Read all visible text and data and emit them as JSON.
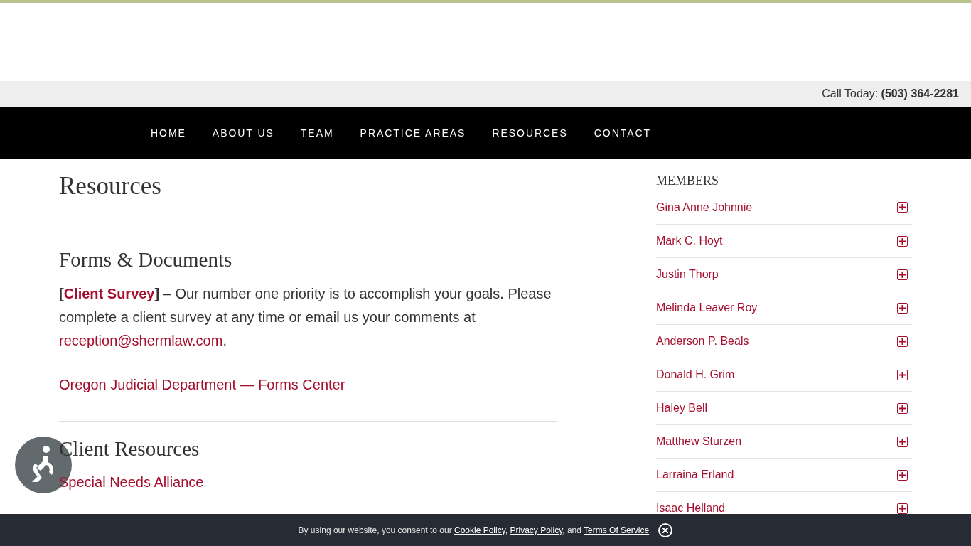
{
  "top_bar": {
    "label": "Call Today:",
    "phone": "(503) 364-2281"
  },
  "nav": [
    "HOME",
    "ABOUT US",
    "TEAM",
    "PRACTICE AREAS",
    "RESOURCES",
    "CONTACT"
  ],
  "page_title": "Resources",
  "sections": [
    {
      "heading": "Forms & Documents",
      "intro": {
        "open": "[",
        "link": "Client Survey",
        "after": "**]** – Our number one priority is to accomplish your goals. Please complete a client survey at any time or email us your comments at",
        "email": "reception@shermlaw.com",
        "end": "."
      },
      "links": [
        "Oregon Judicial Department — Forms Center"
      ]
    },
    {
      "heading": "Client Resources",
      "links": [
        "Special Needs Alliance"
      ]
    }
  ],
  "sidebar": {
    "title": "MEMBERS",
    "members": [
      {
        "name": "Gina Anne Johnnie",
        "expanded": false
      },
      {
        "name": "Mark C. Hoyt",
        "expanded": false
      },
      {
        "name": "Justin Thorp",
        "expanded": false
      },
      {
        "name": "Melinda Leaver Roy",
        "expanded": false
      },
      {
        "name": "Anderson P. Beals",
        "expanded": false
      },
      {
        "name": "Donald H. Grim",
        "expanded": false
      },
      {
        "name": "Haley Bell",
        "expanded": false
      },
      {
        "name": "Matthew Sturzen",
        "expanded": false
      },
      {
        "name": "Larraina Erland",
        "expanded": false
      },
      {
        "name": "Isaac Helland",
        "expanded": false
      }
    ]
  },
  "cookie_banner": {
    "text": "By using our website, you consent to our",
    "links": [
      "Cookie Policy",
      "Privacy Policy",
      "Terms Of Service"
    ],
    "sep1": ",",
    "sep2": ", and",
    "end": "."
  }
}
